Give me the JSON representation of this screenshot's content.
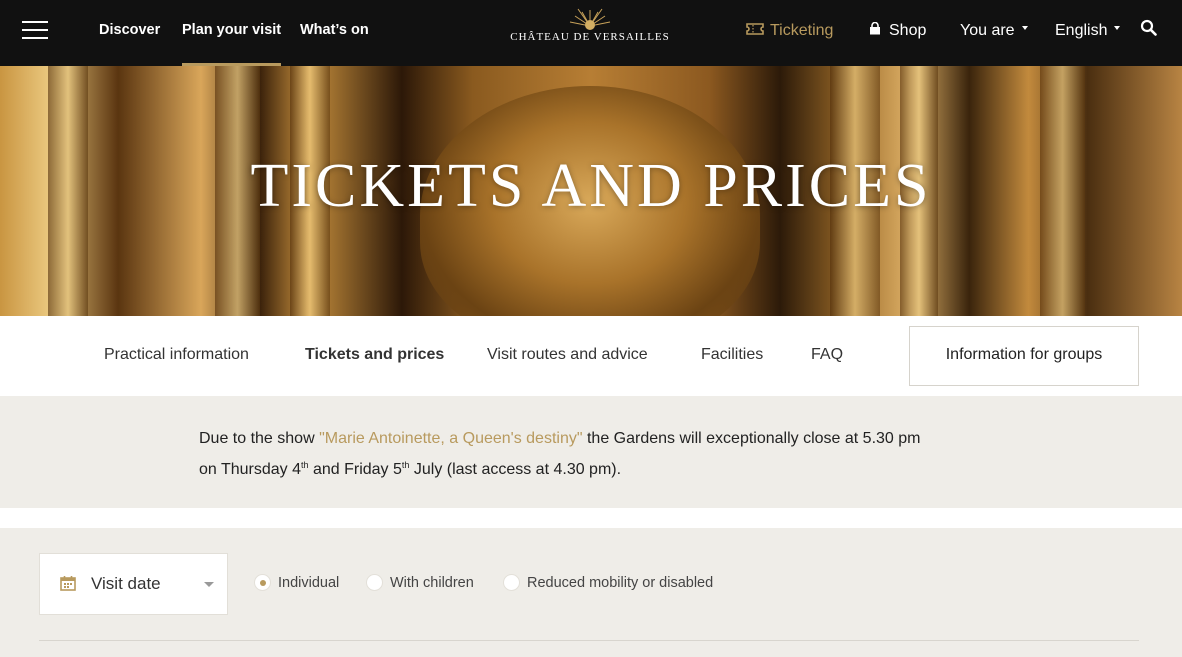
{
  "header": {
    "menu_icon": "hamburger-menu-icon",
    "nav": [
      {
        "label": "Discover"
      },
      {
        "label": "Plan your visit"
      },
      {
        "label": "What’s on"
      }
    ],
    "logo_text": "CHÂTEAU DE VERSAILLES",
    "ticketing_label": "Ticketing",
    "shop_label": "Shop",
    "you_are_label": "You are",
    "language_label": "English",
    "accent_color": "#b89a5e"
  },
  "hero": {
    "title": "TICKETS AND PRICES"
  },
  "subnav": {
    "items": [
      {
        "label": "Practical information"
      },
      {
        "label": "Tickets and prices"
      },
      {
        "label": "Visit routes and advice"
      },
      {
        "label": "Facilities"
      },
      {
        "label": "FAQ"
      }
    ],
    "groups_button": "Information for groups"
  },
  "notice": {
    "prefix": "Due to the show ",
    "link_text": "\"Marie Antoinette, a Queen's destiny\"",
    "mid": " the Gardens will exceptionally close at 5.30 pm",
    "line2_a": "on Thursday 4",
    "sup1": "th",
    "line2_b": " and Friday 5",
    "sup2": "th",
    "line2_c": " July (last access at 4.30 pm)."
  },
  "booking": {
    "date_placeholder": "Visit date",
    "visitor_types": [
      {
        "label": "Individual",
        "selected": true
      },
      {
        "label": "With children",
        "selected": false
      },
      {
        "label": "Reduced mobility or disabled",
        "selected": false
      }
    ]
  }
}
